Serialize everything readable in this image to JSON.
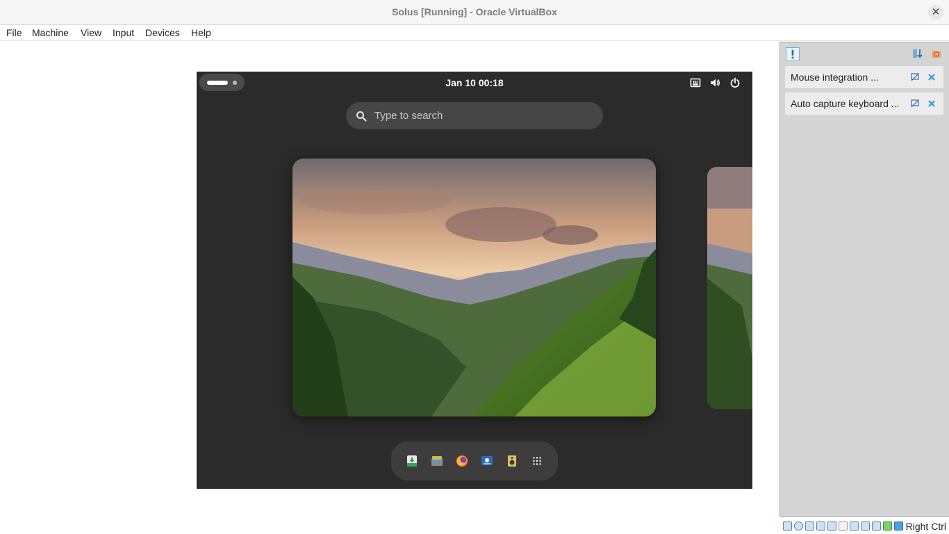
{
  "window": {
    "title": "Solus [Running] - Oracle VirtualBox",
    "close_glyph": "✕"
  },
  "menu": [
    "File",
    "Machine",
    "View",
    "Input",
    "Devices",
    "Help"
  ],
  "guest": {
    "clock": "Jan 10  00:18",
    "search_placeholder": "Type to search",
    "tray_icons": [
      "network-wired-icon",
      "volume-icon",
      "power-icon"
    ],
    "dash_apps": [
      "software-center-icon",
      "files-icon",
      "firefox-icon",
      "screenshot-app-icon",
      "rhythmbox-icon",
      "app-grid-icon"
    ]
  },
  "sidepanel": {
    "notices": [
      {
        "label": "Mouse integration ..."
      },
      {
        "label": "Auto capture keyboard ..."
      }
    ]
  },
  "statusbar": {
    "host_key": "Right Ctrl"
  }
}
